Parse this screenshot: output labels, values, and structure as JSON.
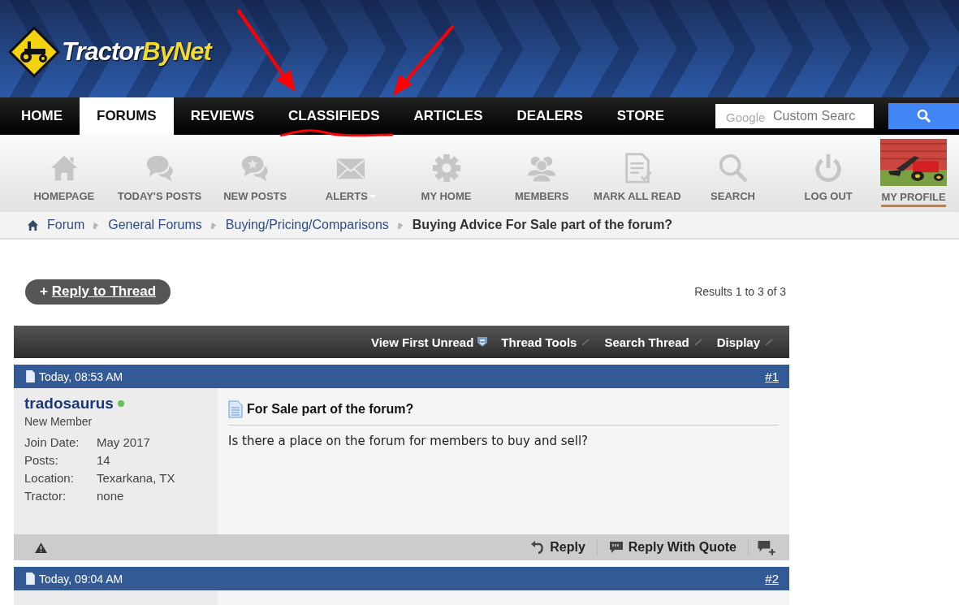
{
  "logo": {
    "part1": "Tractor",
    "part2": "ByNet"
  },
  "nav": {
    "items": [
      {
        "label": "HOME",
        "selected": false
      },
      {
        "label": "FORUMS",
        "selected": true
      },
      {
        "label": "REVIEWS",
        "selected": false
      },
      {
        "label": "CLASSIFIEDS",
        "selected": false
      },
      {
        "label": "ARTICLES",
        "selected": false
      },
      {
        "label": "DEALERS",
        "selected": false
      },
      {
        "label": "STORE",
        "selected": false
      }
    ],
    "search": {
      "brand": "Google",
      "placeholder": "Custom Searc"
    }
  },
  "toolbar": [
    {
      "label": "HOMEPAGE",
      "dropdown": false
    },
    {
      "label": "TODAY'S POSTS",
      "dropdown": false
    },
    {
      "label": "NEW POSTS",
      "dropdown": false
    },
    {
      "label": "ALERTS",
      "dropdown": true
    },
    {
      "label": "MY HOME",
      "dropdown": false
    },
    {
      "label": "MEMBERS",
      "dropdown": false
    },
    {
      "label": "MARK ALL READ",
      "dropdown": false
    },
    {
      "label": "SEARCH",
      "dropdown": false
    },
    {
      "label": "LOG OUT",
      "dropdown": false
    },
    {
      "label": "MY PROFILE",
      "dropdown": false,
      "kind": "picture"
    }
  ],
  "breadcrumb": {
    "links": [
      "Forum",
      "General Forums",
      "Buying/Pricing/Comparisons"
    ],
    "current": "Buying Advice For Sale part of the forum?"
  },
  "reply_button": {
    "plus": "+",
    "label": "Reply to Thread"
  },
  "results": "Results 1 to 3 of 3",
  "thread_tools": [
    {
      "label": "View First Unread",
      "kind": "unread"
    },
    {
      "label": "Thread Tools",
      "kind": "menu"
    },
    {
      "label": "Search Thread",
      "kind": "menu"
    },
    {
      "label": "Display",
      "kind": "menu"
    }
  ],
  "posts": [
    {
      "date": "Today, 08:53 AM",
      "number": "#1",
      "user": "tradosaurus",
      "online": true,
      "rank": "New Member",
      "details": [
        {
          "label": "Join Date:",
          "value": "May 2017"
        },
        {
          "label": "Posts:",
          "value": "14"
        },
        {
          "label": "Location:",
          "value": "Texarkana, TX"
        },
        {
          "label": "Tractor:",
          "value": "none"
        }
      ],
      "title": "For Sale part of the forum?",
      "body": "Is there a place on the forum for members to buy and sell?",
      "actions": [
        "Reply",
        "Reply With Quote"
      ]
    },
    {
      "date": "Today, 09:04 AM",
      "number": "#2"
    }
  ]
}
